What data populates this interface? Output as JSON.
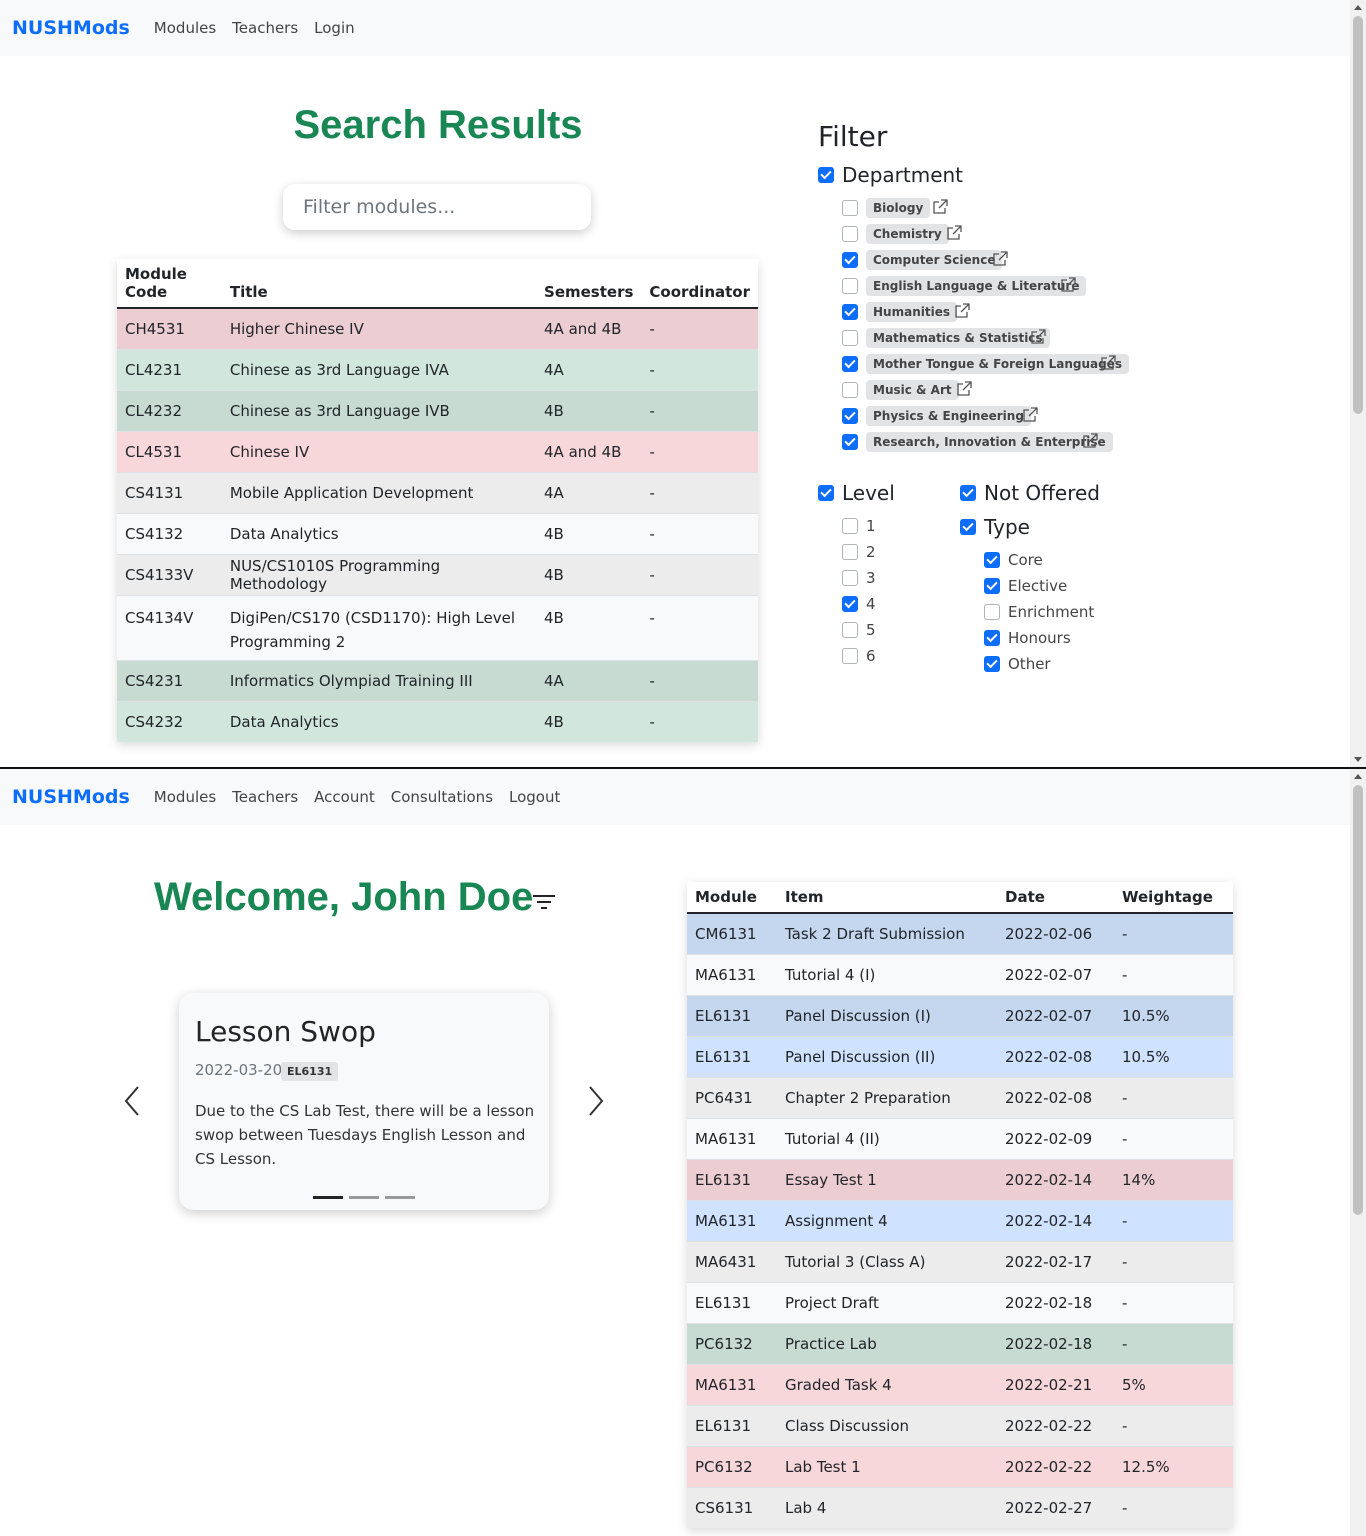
{
  "screen1": {
    "nav": {
      "brand": "NUSHMods",
      "links": [
        "Modules",
        "Teachers",
        "Login"
      ]
    },
    "title": "Search Results",
    "search": {
      "placeholder": "Filter modules..."
    },
    "table": {
      "headers": {
        "code_line1": "Module",
        "code_line2": "Code",
        "title": "Title",
        "semesters": "Semesters",
        "coordinator": "Coordinator"
      },
      "rows": [
        {
          "code": "CH4531",
          "title": "Higher Chinese IV",
          "sem": "4A and 4B",
          "coord": "-"
        },
        {
          "code": "CL4231",
          "title": "Chinese as 3rd Language IVA",
          "sem": "4A",
          "coord": "-"
        },
        {
          "code": "CL4232",
          "title": "Chinese as 3rd Language IVB",
          "sem": "4B",
          "coord": "-"
        },
        {
          "code": "CL4531",
          "title": "Chinese IV",
          "sem": "4A and 4B",
          "coord": "-"
        },
        {
          "code": "CS4131",
          "title": "Mobile Application Development",
          "sem": "4A",
          "coord": "-"
        },
        {
          "code": "CS4132",
          "title": "Data Analytics",
          "sem": "4B",
          "coord": "-"
        },
        {
          "code": "CS4133V",
          "title": "NUS/CS1010S Programming Methodology",
          "sem": "4B",
          "coord": "-"
        },
        {
          "code": "CS4134V",
          "title_line1": "DigiPen/CS170 (CSD1170): High Level",
          "title_line2": "Programming 2",
          "sem": "4B",
          "coord": "-"
        },
        {
          "code": "CS4231",
          "title": "Informatics Olympiad Training III",
          "sem": "4A",
          "coord": "-"
        },
        {
          "code": "CS4232",
          "title": "Data Analytics",
          "sem": "4B",
          "coord": "-"
        }
      ]
    },
    "filter": {
      "title": "Filter",
      "department": {
        "label": "Department",
        "checked": true,
        "items": [
          {
            "label": "Biology",
            "checked": false
          },
          {
            "label": "Chemistry",
            "checked": false
          },
          {
            "label": "Computer Science",
            "checked": true
          },
          {
            "label": "English Language & Literature",
            "checked": false
          },
          {
            "label": "Humanities",
            "checked": true
          },
          {
            "label": "Mathematics & Statistics",
            "checked": false
          },
          {
            "label": "Mother Tongue & Foreign Languages",
            "checked": true
          },
          {
            "label": "Music & Art",
            "checked": false
          },
          {
            "label": "Physics & Engineering",
            "checked": true
          },
          {
            "label": "Research, Innovation & Enterprise",
            "checked": true
          }
        ]
      },
      "level": {
        "label": "Level",
        "checked": true,
        "items": [
          {
            "label": "1",
            "checked": false
          },
          {
            "label": "2",
            "checked": false
          },
          {
            "label": "3",
            "checked": false
          },
          {
            "label": "4",
            "checked": true
          },
          {
            "label": "5",
            "checked": false
          },
          {
            "label": "6",
            "checked": false
          }
        ]
      },
      "not_offered": {
        "label": "Not Offered",
        "checked": true
      },
      "type": {
        "label": "Type",
        "checked": true,
        "items": [
          {
            "label": "Core",
            "checked": true
          },
          {
            "label": "Elective",
            "checked": true
          },
          {
            "label": "Enrichment",
            "checked": false
          },
          {
            "label": "Honours",
            "checked": true
          },
          {
            "label": "Other",
            "checked": true
          }
        ]
      }
    }
  },
  "screen2": {
    "nav": {
      "brand": "NUSHMods",
      "links": [
        "Modules",
        "Teachers",
        "Account",
        "Consultations",
        "Logout"
      ]
    },
    "welcome": "Welcome, John Doe",
    "card": {
      "title": "Lesson Swop",
      "date": "2022-03-20",
      "module": "EL6131",
      "text": "Due to the CS Lab Test, there will be a lesson swop between Tuesdays English Lesson and CS Lesson."
    },
    "table": {
      "headers": {
        "module": "Module",
        "item": "Item",
        "date": "Date",
        "weightage": "Weightage"
      },
      "rows": [
        {
          "module": "CM6131",
          "item": "Task 2 Draft Submission",
          "date": "2022-02-06",
          "weightage": "-"
        },
        {
          "module": "MA6131",
          "item": "Tutorial 4 (I)",
          "date": "2022-02-07",
          "weightage": "-"
        },
        {
          "module": "EL6131",
          "item": "Panel Discussion (I)",
          "date": "2022-02-07",
          "weightage": "10.5%"
        },
        {
          "module": "EL6131",
          "item": "Panel Discussion (II)",
          "date": "2022-02-08",
          "weightage": "10.5%"
        },
        {
          "module": "PC6431",
          "item": "Chapter 2 Preparation",
          "date": "2022-02-08",
          "weightage": "-"
        },
        {
          "module": "MA6131",
          "item": "Tutorial 4 (II)",
          "date": "2022-02-09",
          "weightage": "-"
        },
        {
          "module": "EL6131",
          "item": "Essay Test 1",
          "date": "2022-02-14",
          "weightage": "14%"
        },
        {
          "module": "MA6131",
          "item": "Assignment 4",
          "date": "2022-02-14",
          "weightage": "-"
        },
        {
          "module": "MA6431",
          "item": "Tutorial 3 (Class A)",
          "date": "2022-02-17",
          "weightage": "-"
        },
        {
          "module": "EL6131",
          "item": "Project Draft",
          "date": "2022-02-18",
          "weightage": "-"
        },
        {
          "module": "PC6132",
          "item": "Practice Lab",
          "date": "2022-02-18",
          "weightage": "-"
        },
        {
          "module": "MA6131",
          "item": "Graded Task 4",
          "date": "2022-02-21",
          "weightage": "5%"
        },
        {
          "module": "EL6131",
          "item": "Class Discussion",
          "date": "2022-02-22",
          "weightage": "-"
        },
        {
          "module": "PC6132",
          "item": "Lab Test 1",
          "date": "2022-02-22",
          "weightage": "12.5%"
        },
        {
          "module": "CS6131",
          "item": "Lab 4",
          "date": "2022-02-27",
          "weightage": "-"
        }
      ]
    }
  }
}
